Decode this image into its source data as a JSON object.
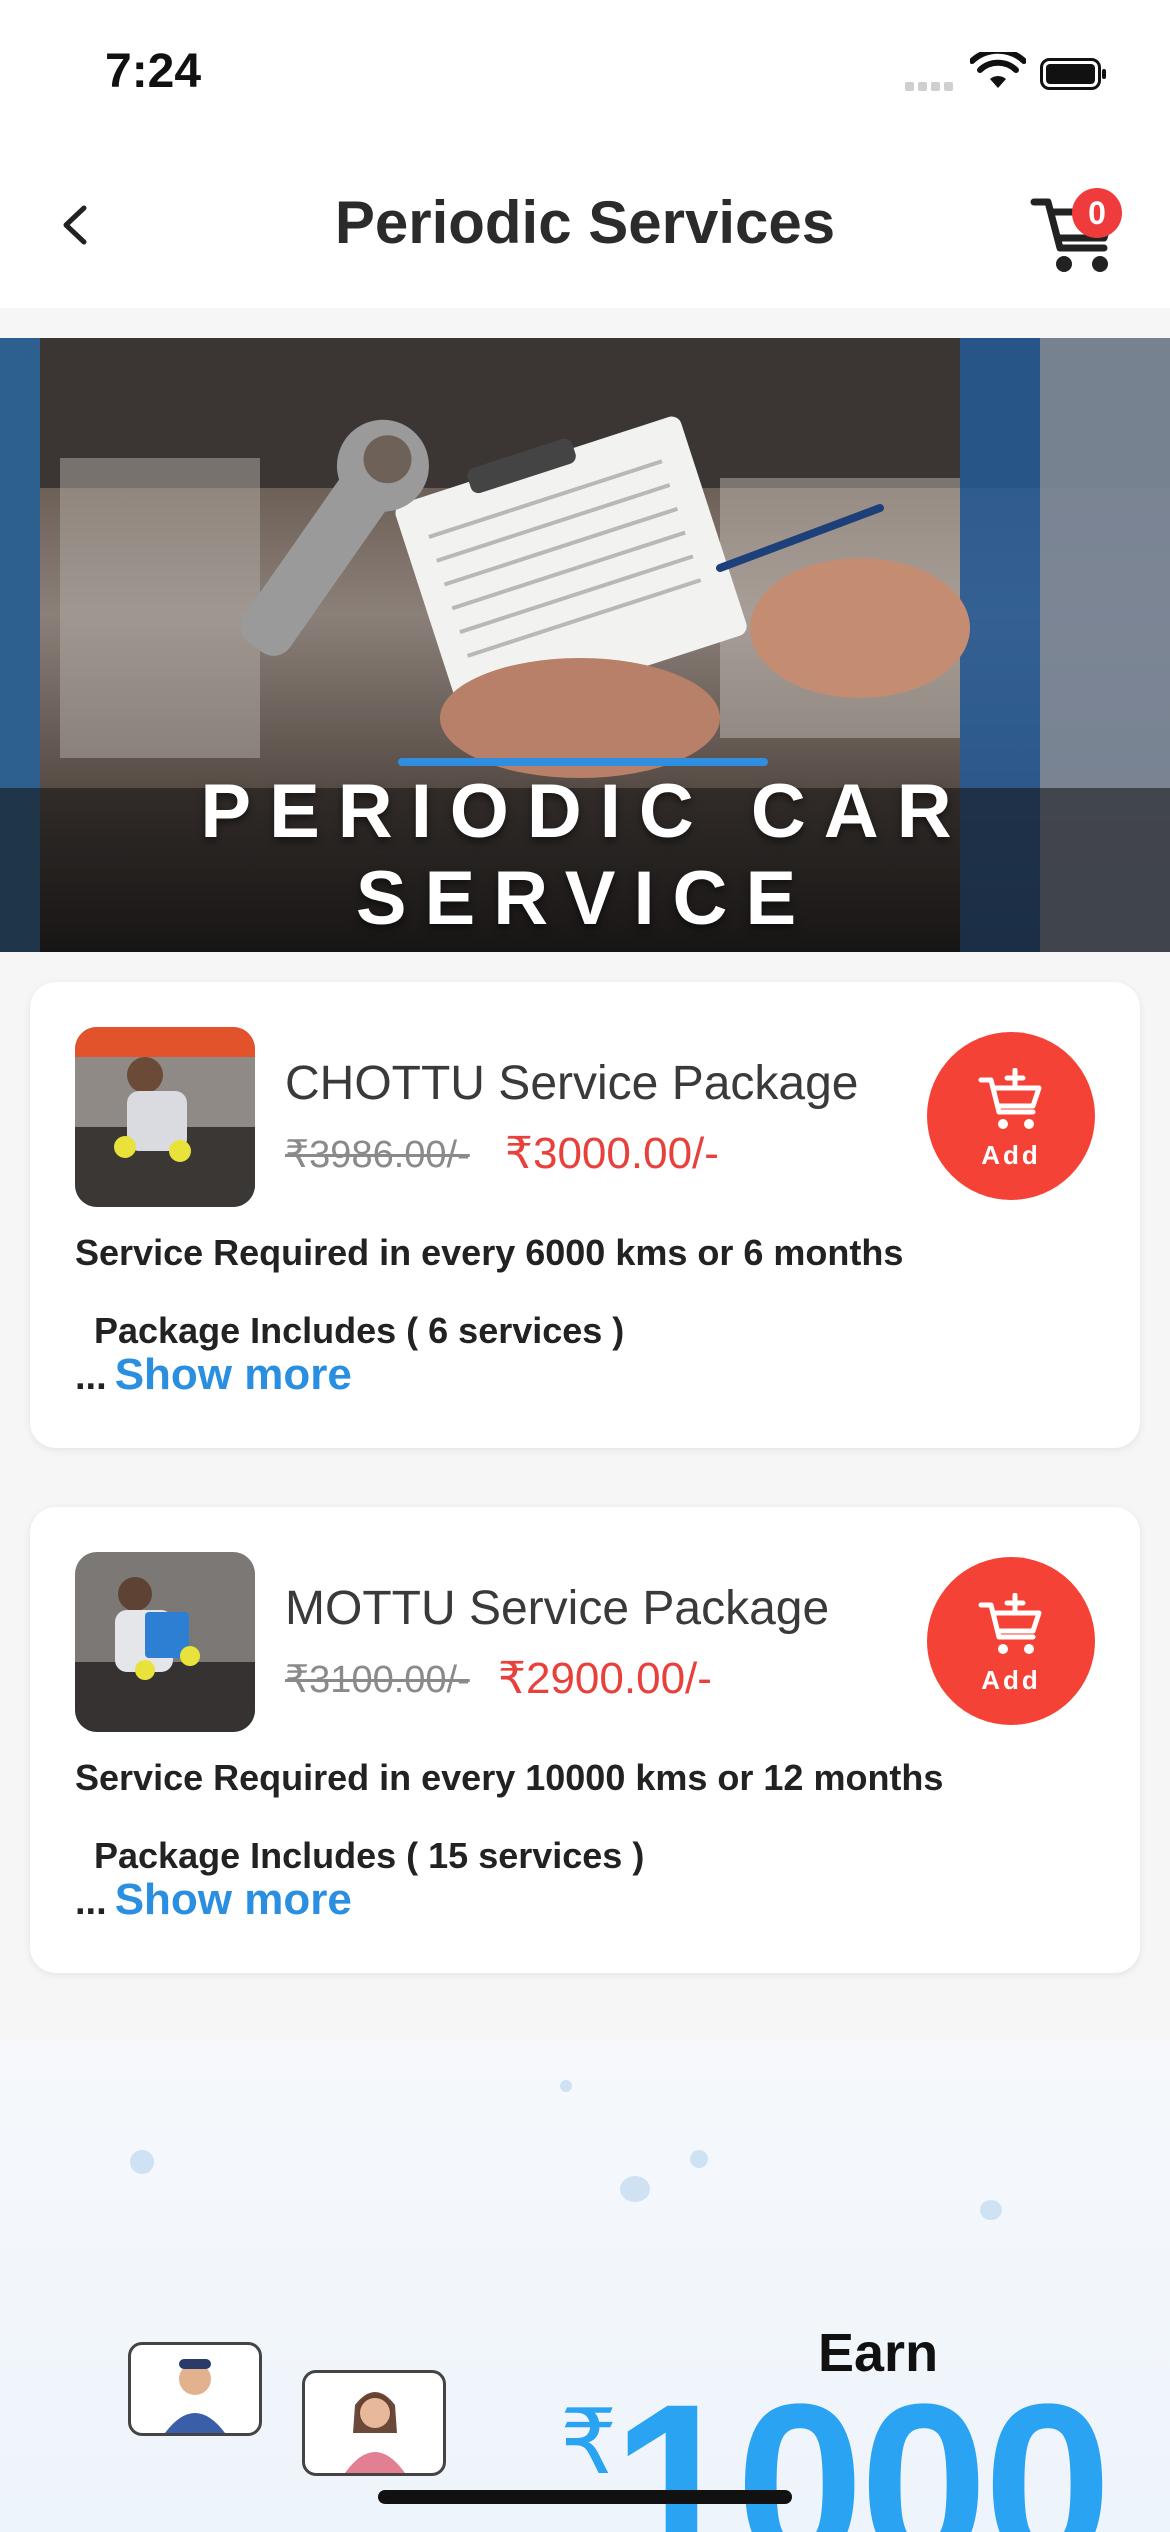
{
  "status_bar": {
    "time": "7:24"
  },
  "header": {
    "title": "Periodic Services",
    "cart_count": "0"
  },
  "banner": {
    "text": "PERIODIC CAR SERVICE"
  },
  "packages": [
    {
      "name": "CHOTTU Service Package",
      "old_price": "₹3986.00/-",
      "new_price": "₹3000.00/-",
      "add_label": "Add",
      "service_required": "Service Required in every 6000 kms or 6 months",
      "includes": "Package Includes ( 6 services )",
      "ellipsis": "...",
      "show_more": "Show more"
    },
    {
      "name": "MOTTU Service Package",
      "old_price": "₹3100.00/-",
      "new_price": "₹2900.00/-",
      "add_label": "Add",
      "service_required": "Service Required in every 10000 kms or 12 months",
      "includes": "Package Includes ( 15 services )",
      "ellipsis": "...",
      "show_more": "Show more"
    }
  ],
  "promo": {
    "earn": "Earn",
    "currency": "₹",
    "amount": "1000"
  },
  "colors": {
    "accent_red": "#f44336",
    "price_red": "#e8413c",
    "link_blue": "#2a8fe0",
    "promo_blue": "#29a3f2"
  }
}
